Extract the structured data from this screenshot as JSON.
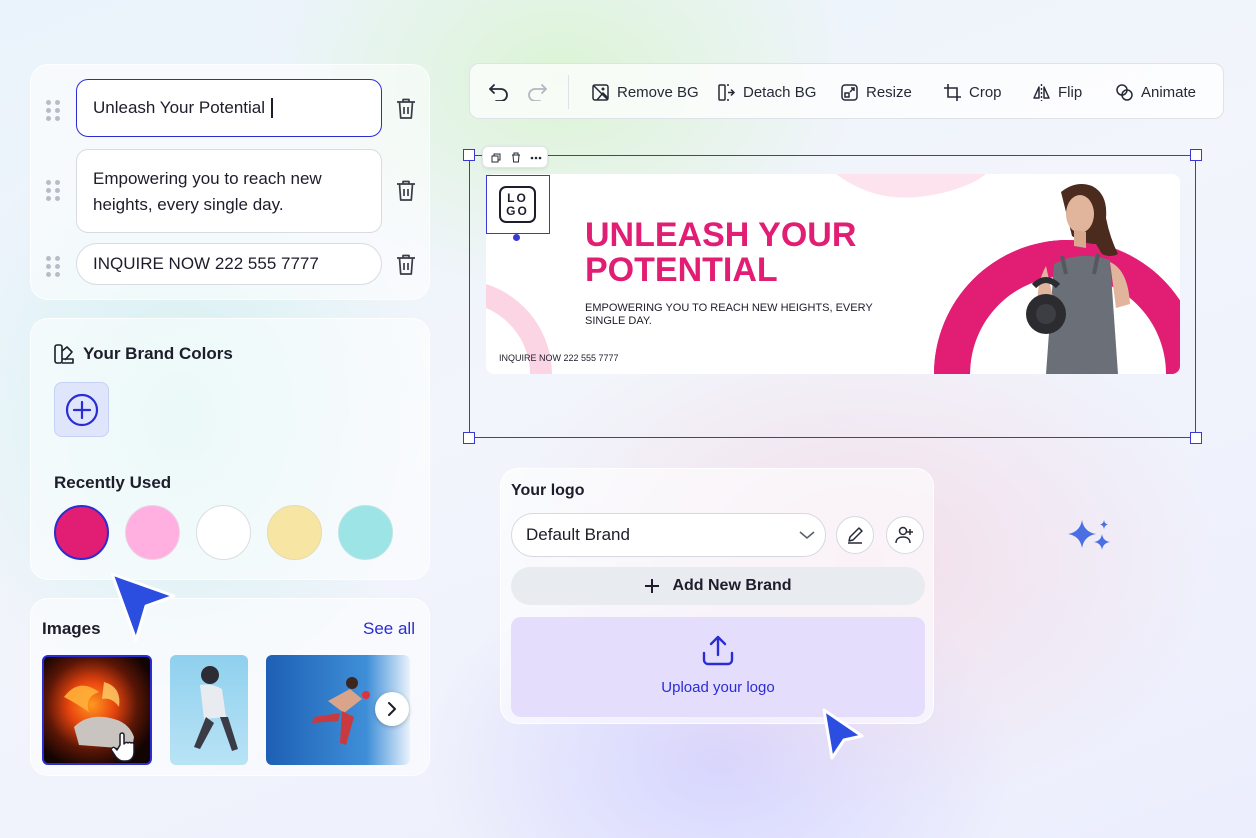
{
  "text_fields": [
    {
      "value": "Unleash Your Potential"
    },
    {
      "line1": "Empowering you to reach new",
      "line2": "heights, every single day."
    },
    {
      "value": "INQUIRE NOW 222 555 7777"
    }
  ],
  "brand_colors": {
    "title": "Your Brand Colors",
    "recent_label": "Recently Used",
    "recent": [
      "#e11d74",
      "#ffafe0",
      "#ffffff",
      "#f7e6a3",
      "#9ce4e5"
    ]
  },
  "images": {
    "title": "Images",
    "see_all": "See all"
  },
  "toolbar": {
    "remove_bg": "Remove BG",
    "detach_bg": "Detach BG",
    "resize": "Resize",
    "crop": "Crop",
    "flip": "Flip",
    "animate": "Animate"
  },
  "banner": {
    "logo_text_1": "LO",
    "logo_text_2": "GO",
    "headline_1": "UNLEASH YOUR",
    "headline_2": "POTENTIAL",
    "sub_1": "EMPOWERING YOU TO REACH NEW HEIGHTS, EVERY",
    "sub_2": "SINGLE DAY.",
    "contact": "INQUIRE NOW 222 555 7777",
    "accent": "#e11d74"
  },
  "logo_panel": {
    "title": "Your logo",
    "brand_select": "Default Brand",
    "add_brand": "Add New Brand",
    "upload": "Upload your logo"
  },
  "colors": {
    "primary": "#2b2cd4",
    "accent": "#e11d74"
  }
}
